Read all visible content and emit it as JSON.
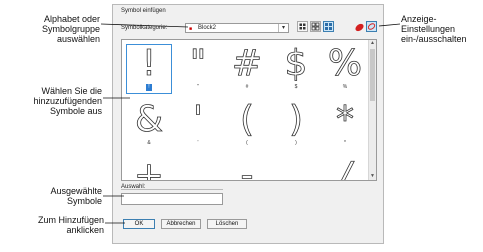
{
  "callouts": {
    "alphabet": "Alphabet oder\nSymbolgruppe\nauswählen",
    "choose_symbols": "Wählen Sie die\nhinzuzufügenden\nSymbole aus",
    "selected": "Ausgewählte\nSymbole",
    "add": "Zum Hinzufügen\nanklicken",
    "display": "Anzeige-\nEinstellungen\nein-/ausschalten"
  },
  "dialog": {
    "title": "Symbol einfügen",
    "category_label": "Symbolkategorie:",
    "category_value": "Block2",
    "selection_label": "Auswahl:",
    "buttons": {
      "ok": "OK",
      "cancel": "Abbrechen",
      "delete": "Löschen"
    }
  },
  "symbols": [
    {
      "glyph": "!",
      "caption": "!",
      "selected": true
    },
    {
      "glyph": "\"",
      "caption": "\"",
      "selected": false
    },
    {
      "glyph": "#",
      "caption": "#",
      "selected": false
    },
    {
      "glyph": "$",
      "caption": "$",
      "selected": false
    },
    {
      "glyph": "%",
      "caption": "%",
      "selected": false
    },
    {
      "glyph": "&",
      "caption": "&",
      "selected": false
    },
    {
      "glyph": "'",
      "caption": "'",
      "selected": false
    },
    {
      "glyph": "(",
      "caption": "(",
      "selected": false
    },
    {
      "glyph": ")",
      "caption": ")",
      "selected": false
    },
    {
      "glyph": "*",
      "caption": "*",
      "selected": false
    },
    {
      "glyph": "+",
      "caption": "",
      "selected": false
    },
    {
      "glyph": ",",
      "caption": "",
      "selected": false
    },
    {
      "glyph": "-",
      "caption": "",
      "selected": false
    },
    {
      "glyph": ".",
      "caption": "",
      "selected": false
    },
    {
      "glyph": "/",
      "caption": "",
      "selected": false
    }
  ],
  "icons": {
    "category_icon": "font-icon",
    "view_small": "small-grid-icon",
    "view_medium": "medium-grid-icon",
    "view_large": "large-grid-icon",
    "display_red": "red-shape-icon",
    "display_outline": "outline-shape-icon"
  },
  "colors": {
    "selection": "#2d7dd2",
    "accent": "#3c8fd8",
    "icon_red": "#d42020"
  }
}
